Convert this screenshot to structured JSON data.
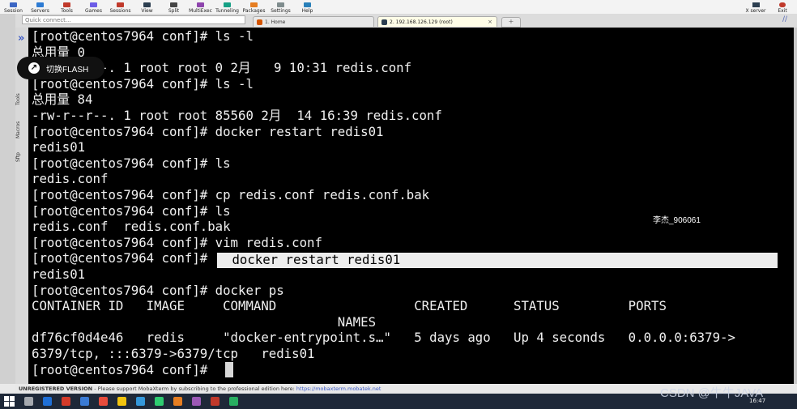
{
  "toolbar": {
    "items": [
      "Session",
      "Servers",
      "Tools",
      "Games",
      "Sessions",
      "View",
      "Split",
      "MultiExec",
      "Tunneling",
      "Packages",
      "Settings",
      "Help"
    ],
    "icon_colors": [
      "#3b66c4",
      "#2d7bd3",
      "#c0392b",
      "#6c5ce7",
      "#c0392b",
      "#2c3e50",
      "#444",
      "#8e44ad",
      "#16a085",
      "#e67e22",
      "#7f8c8d",
      "#2980b9"
    ],
    "right": [
      "X server",
      "Exit"
    ]
  },
  "quick_connect": {
    "placeholder": "Quick connect..."
  },
  "tabs": {
    "home": "1. Home",
    "ssh": "2. 192.168.126.129 (root)",
    "close": "×",
    "new": "+"
  },
  "sidebar": {
    "labels": [
      "Tools",
      "Macros",
      "Sftp"
    ],
    "arrow": "»"
  },
  "flash": {
    "label": "切换FLASH"
  },
  "terminal": {
    "lines": [
      "[root@centos7964 conf]# ls -l",
      "总用量 0",
      "-rw-r--r--. 1 root root 0 2月   9 10:31 redis.conf",
      "[root@centos7964 conf]# ls -l",
      "总用量 84",
      "-rw-r--r--. 1 root root 85560 2月  14 16:39 redis.conf",
      "[root@centos7964 conf]# docker restart redis01",
      "redis01",
      "[root@centos7964 conf]# ls",
      "redis.conf",
      "[root@centos7964 conf]# cp redis.conf redis.conf.bak",
      "[root@centos7964 conf]# ls",
      "redis.conf  redis.conf.bak",
      "[root@centos7964 conf]# vim redis.conf",
      "[root@centos7964 conf]#",
      "redis01",
      "[root@centos7964 conf]# docker ps",
      "CONTAINER ID   IMAGE     COMMAND                  CREATED      STATUS         PORTS",
      "                                        NAMES",
      "df76cf0d4e46   redis     \"docker-entrypoint.s…\"   5 days ago   Up 4 seconds   0.0.0.0:6379->",
      "6379/tcp, :::6379->6379/tcp   redis01",
      "[root@centos7964 conf]#"
    ],
    "highlight": " docker restart redis01",
    "watermark_name": "李杰_906061"
  },
  "status": {
    "unregistered": "UNREGISTERED VERSION",
    "message": " -  Please support MobaXterm by subscribing to the professional edition here: ",
    "link": "https://mobaxterm.mobatek.net"
  },
  "taskbar": {
    "icon_colors": [
      "#ffffff",
      "#1f6fd6",
      "#d43b2a",
      "#3a7bd5",
      "#e74c3c",
      "#f1c40f",
      "#3498db",
      "#2ecc71",
      "#e67e22",
      "#9b59b6",
      "#c0392b",
      "#27ae60"
    ],
    "clock": "16:47"
  },
  "watermark": "CSDN @牛牛JAVA"
}
